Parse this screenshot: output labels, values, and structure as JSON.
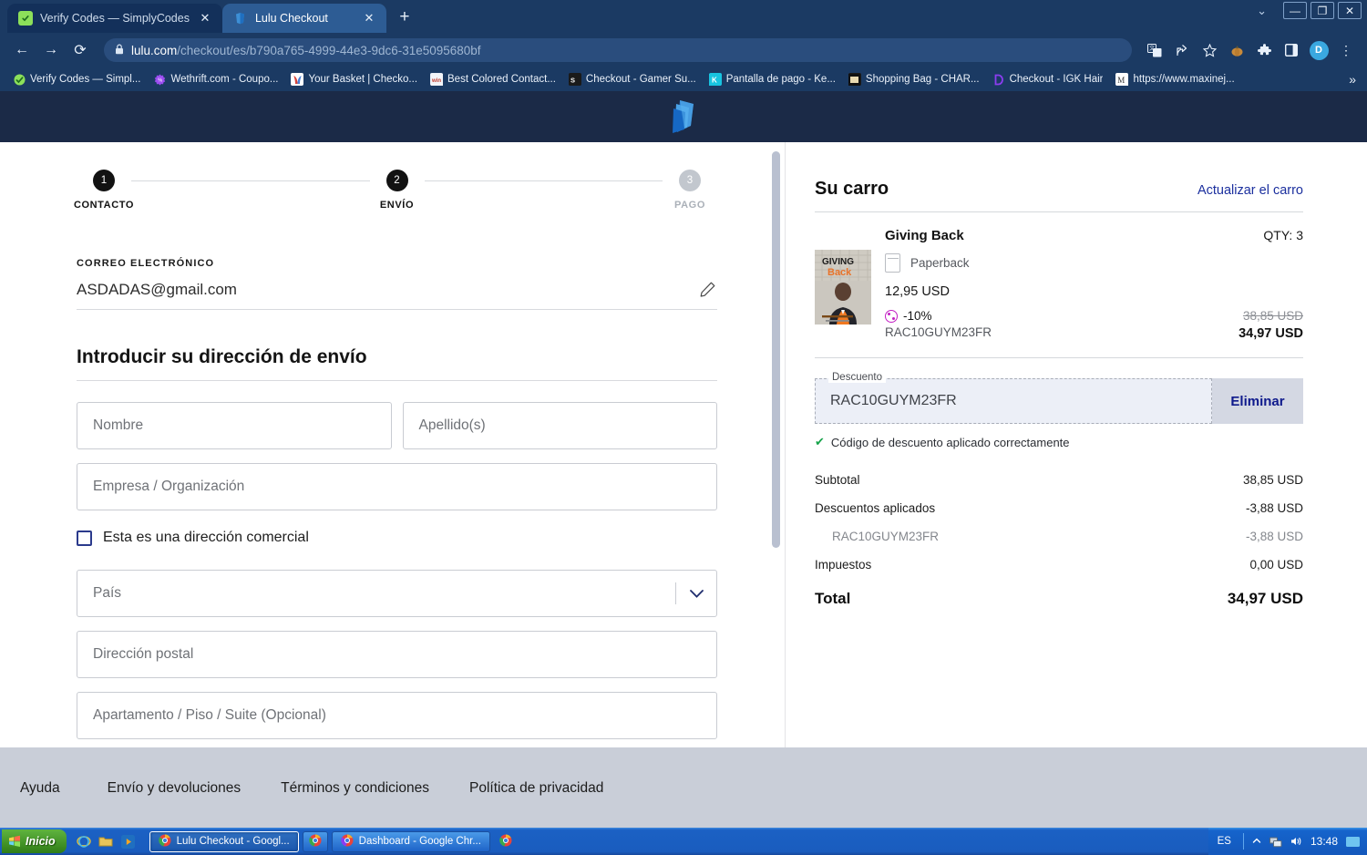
{
  "browser": {
    "tabs": [
      {
        "title": "Verify Codes — SimplyCodes",
        "favicon": "simplycodes-icon",
        "active": false
      },
      {
        "title": "Lulu Checkout",
        "favicon": "lulu-icon",
        "active": true
      }
    ],
    "new_tab_label": "+",
    "window_controls": {
      "chevron": "⌄",
      "minimize": "—",
      "restore": "❐",
      "close": "✕"
    },
    "nav": {
      "back": "←",
      "forward": "→",
      "reload": "⟳"
    },
    "omnibox": {
      "lock_icon": "lock-icon",
      "url_host": "lulu.com",
      "url_path": "/checkout/es/b790a765-4999-44e3-9dc6-31e5095680bf"
    },
    "toolbar_icons": [
      "translate-icon",
      "share-icon",
      "bookmark-star-icon",
      "pumpkin-icon",
      "extensions-icon",
      "sidebar-icon"
    ],
    "profile_initial": "D",
    "menu_icon": "⋮",
    "bookmarks": [
      {
        "label": "Verify Codes — Simpl...",
        "favicon": "simplycodes-icon"
      },
      {
        "label": "Wethrift.com - Coupo...",
        "favicon": "wethrift-icon"
      },
      {
        "label": "Your Basket | Checko...",
        "favicon": "basket-icon"
      },
      {
        "label": "Best Colored Contact...",
        "favicon": "contacts-icon"
      },
      {
        "label": "Checkout - Gamer Su...",
        "favicon": "gamer-icon"
      },
      {
        "label": "Pantalla de pago - Ke...",
        "favicon": "ke-icon"
      },
      {
        "label": "Shopping Bag - CHAR...",
        "favicon": "charlotte-icon"
      },
      {
        "label": "Checkout - IGK Hair",
        "favicon": "igk-icon"
      },
      {
        "label": "https://www.maxinej...",
        "favicon": "maxine-icon"
      }
    ],
    "bookmarks_overflow": "»"
  },
  "site": {
    "logo_name": "lulu-logo",
    "steps": [
      {
        "number": "1",
        "label": "CONTACTO",
        "state": "done"
      },
      {
        "number": "2",
        "label": "ENVÍO",
        "state": "current"
      },
      {
        "number": "3",
        "label": "PAGO",
        "state": "pending"
      }
    ],
    "email": {
      "label": "CORREO ELECTRÓNICO",
      "value": "ASDADAS@gmail.com",
      "edit_icon": "pencil-icon"
    },
    "shipping": {
      "title": "Introducir su dirección de envío",
      "first_name_placeholder": "Nombre",
      "last_name_placeholder": "Apellido(s)",
      "company_placeholder": "Empresa / Organización",
      "commercial_checkbox_label": "Esta es una dirección comercial",
      "country_placeholder": "País",
      "address_placeholder": "Dirección postal",
      "apartment_placeholder": "Apartamento / Piso / Suite (Opcional)"
    },
    "cart": {
      "title": "Su carro",
      "update_link": "Actualizar el carro",
      "item": {
        "name": "Giving Back",
        "qty_label": "QTY: 3",
        "format": "Paperback",
        "format_icon": "book-icon",
        "unit_price": "12,95 USD",
        "discount_percent": "-10%",
        "discount_code": "RAC10GUYM23FR",
        "original_total": "38,85 USD",
        "discounted_total": "34,97 USD",
        "discount_icon": "tag-icon"
      },
      "promo": {
        "legend": "Descuento",
        "value": "RAC10GUYM23FR",
        "remove_label": "Eliminar",
        "success_icon": "check-icon",
        "success_message": "Código de descuento aplicado correctamente"
      },
      "totals": [
        {
          "label": "Subtotal",
          "value": "38,85 USD",
          "type": "normal"
        },
        {
          "label": "Descuentos aplicados",
          "value": "-3,88 USD",
          "type": "normal"
        },
        {
          "label": "RAC10GUYM23FR",
          "value": "-3,88 USD",
          "type": "sub"
        },
        {
          "label": "Impuestos",
          "value": "0,00 USD",
          "type": "normal"
        }
      ],
      "grand_total": {
        "label": "Total",
        "value": "34,97 USD"
      }
    },
    "footer_links": [
      "Ayuda",
      "Envío y devoluciones",
      "Términos y condiciones",
      "Política de privacidad"
    ]
  },
  "taskbar": {
    "start_label": "Inicio",
    "quick_launch": [
      "ie-icon",
      "folder-icon",
      "media-player-icon"
    ],
    "tasks": [
      {
        "label": "Lulu Checkout - Googl...",
        "icon": "chrome-icon",
        "focused": true
      },
      {
        "label": "Dashboard - Google Chr...",
        "icon": "chrome-icon",
        "focused": false
      }
    ],
    "tray": {
      "language": "ES",
      "icons": [
        "show-hidden-icon",
        "network-icon",
        "volume-icon"
      ],
      "clock": "13:48"
    }
  },
  "colors": {
    "browser_chrome": "#1b3a63",
    "site_header": "#1b2a47",
    "accent_link": "#1b2f9e",
    "footer_bg": "#c9ced8",
    "discount_magenta": "#c31fc3",
    "success_green": "#16a34a"
  }
}
